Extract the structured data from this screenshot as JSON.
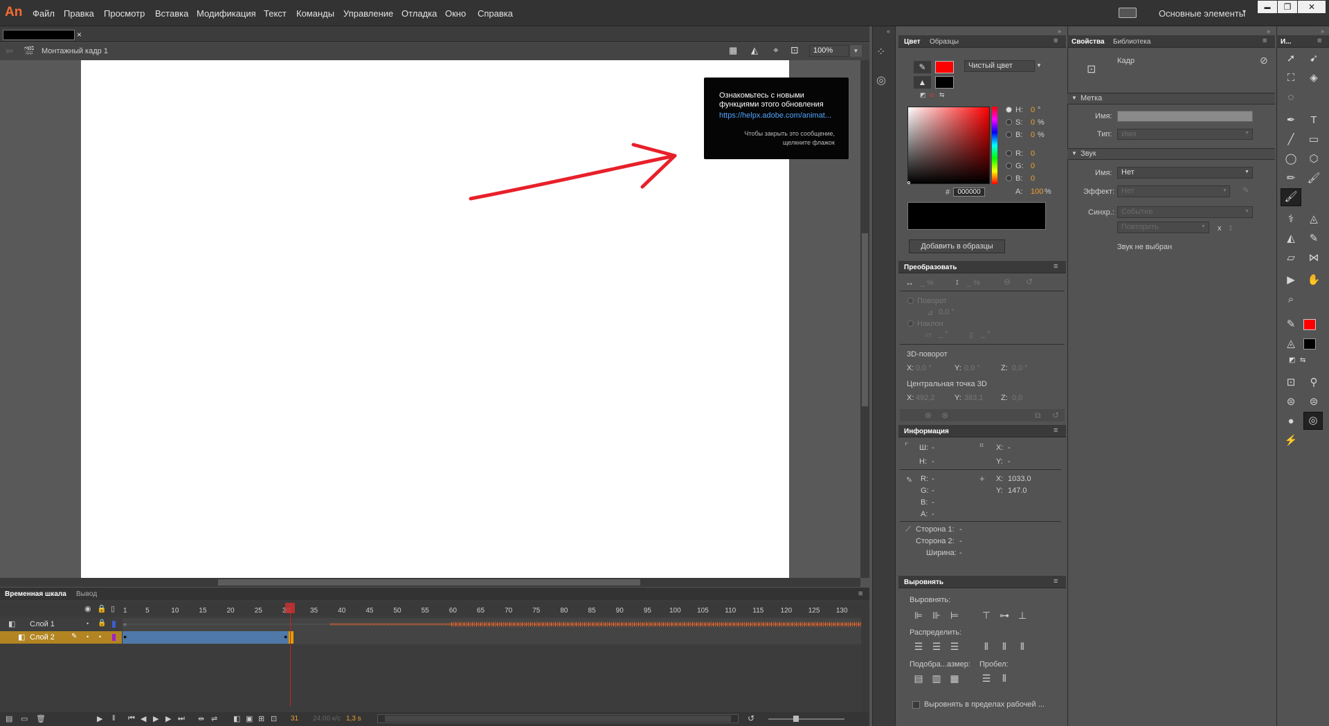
{
  "app": {
    "logo": "An",
    "workspace": "Основные элементы",
    "workspace_caret": "▾"
  },
  "menu": [
    "Файл",
    "Правка",
    "Просмотр",
    "Вставка",
    "Модификация",
    "Текст",
    "Команды",
    "Управление",
    "Отладка",
    "Окно",
    "Справка"
  ],
  "window_controls": {
    "minimize": "▬",
    "restore": "❐",
    "close": "✕"
  },
  "document": {
    "tab_title": "",
    "tab_close": "×",
    "scene_label": "Монтажный кадр 1",
    "zoom": "100%"
  },
  "tooltip": {
    "line1": "Ознакомьтесь с новыми",
    "line2": "функциями этого обновления",
    "link": "https://helpx.adobe.com/animat...",
    "note1": "Чтобы закрыть это сообщение,",
    "note2": "щелкните флажок"
  },
  "colors": {
    "arrow": "#e8202a",
    "stroke_swatch": "#ff0000",
    "fill_swatch": "#000000",
    "playhead": "#cc2222",
    "layer_highlight": "#b28522",
    "span_blue": "#4f79a8",
    "wave": "#d4602a"
  },
  "color_panel": {
    "tabs": [
      "Цвет",
      "Образцы"
    ],
    "type": "Чистый цвет",
    "hsb": [
      {
        "k": "H:",
        "v": "0",
        "u": "°"
      },
      {
        "k": "S:",
        "v": "0",
        "u": "%"
      },
      {
        "k": "B:",
        "v": "0",
        "u": "%"
      }
    ],
    "rgb": [
      {
        "k": "R:",
        "v": "0"
      },
      {
        "k": "G:",
        "v": "0"
      },
      {
        "k": "B:",
        "v": "0"
      }
    ],
    "alpha": {
      "k": "A:",
      "v": "100",
      "u": "%"
    },
    "hex_prefix": "#",
    "hex": "000000",
    "add_button": "Добавить в образцы"
  },
  "transform": {
    "title": "Преобразовать",
    "width_pct": "_ %",
    "height_pct": "_ %",
    "rotate_label": "Поворот",
    "rotate_value": "0,0 °",
    "skew_label": "Наклон",
    "skew_x": "_ °",
    "skew_y": "_ °",
    "rotation3d": "3D-поворот",
    "r3d": [
      {
        "k": "X:",
        "v": "0,0 °"
      },
      {
        "k": "Y:",
        "v": "0,0 °"
      },
      {
        "k": "Z:",
        "v": "0,0 °"
      }
    ],
    "center3d": "Центральная точка 3D",
    "c3d": [
      {
        "k": "X:",
        "v": "492,2"
      },
      {
        "k": "Y:",
        "v": "383,1"
      },
      {
        "k": "Z:",
        "v": "0,0"
      }
    ]
  },
  "info": {
    "title": "Информация",
    "w": "Ш:",
    "w_v": "-",
    "h": "H:",
    "h_v": "-",
    "x1": "X:",
    "x1_v": "-",
    "y1": "Y:",
    "y1_v": "-",
    "r": "R:",
    "r_v": "-",
    "g": "G:",
    "g_v": "-",
    "b": "B:",
    "b_v": "-",
    "a": "A:",
    "a_v": "-",
    "x2": "X:",
    "x2_v": "1033.0",
    "y2": "Y:",
    "y2_v": "147.0",
    "side1": "Сторона 1:",
    "side1_v": "-",
    "side2": "Сторона 2:",
    "side2_v": "-",
    "width": "Ширина:",
    "width_v": "-"
  },
  "align": {
    "title": "Выровнять",
    "align_label": "Выровнять:",
    "distribute_label": "Распределить:",
    "match_label": "Подобра...азмер:",
    "space_label": "Пробел:",
    "to_stage": "Выровнять в пределах рабочей ..."
  },
  "properties": {
    "tabs": [
      "Свойства",
      "Библиотека"
    ],
    "object": "Кадр",
    "label_section": "Метка",
    "name_label": "Имя:",
    "name_value": "",
    "type_label": "Тип:",
    "type_value": "Имя",
    "sound_section": "Звук",
    "sound_name_label": "Имя:",
    "sound_name": "Нет",
    "effect_label": "Эффект:",
    "effect": "Нет",
    "sync_label": "Синхр.:",
    "sync": "Событие",
    "repeat": "Повторить",
    "repeat_x": "x",
    "repeat_count": "1",
    "no_sound": "Звук не выбран"
  },
  "tools_header": "И...",
  "timeline": {
    "tabs": [
      "Временная шкала",
      "Вывод"
    ],
    "ruler": [
      "1",
      "5",
      "10",
      "15",
      "20",
      "25",
      "30",
      "35",
      "40",
      "45",
      "50",
      "55",
      "60",
      "65",
      "70",
      "75",
      "80",
      "85",
      "90",
      "95",
      "100",
      "105",
      "110",
      "115",
      "120",
      "125",
      "130"
    ],
    "layers": [
      {
        "name": "Слой 1"
      },
      {
        "name": "Слой 2"
      }
    ],
    "current_frame": "31",
    "fps": "24,00 к/с",
    "time": "1,3 s"
  }
}
